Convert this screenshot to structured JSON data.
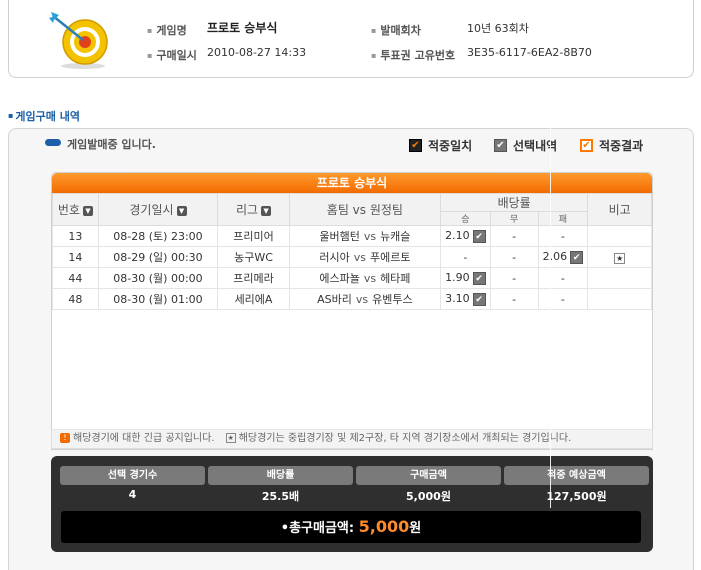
{
  "info": {
    "game_name_label": "게임명",
    "game_name": "프로토 승부식",
    "round_label": "발매회차",
    "round": "10년 63회차",
    "purchase_date_label": "구매일시",
    "purchase_date": "2010-08-27 14:33",
    "ticket_id_label": "투표권 고유번호",
    "ticket_id": "3E35-6117-6EA2-8B70"
  },
  "section_title": "게임구매 내역",
  "status_text": "게임발매중 입니다.",
  "legend": [
    {
      "label": "적중일치",
      "style": "black"
    },
    {
      "label": "선택내역",
      "style": "gray"
    },
    {
      "label": "적중결과",
      "style": "orange"
    }
  ],
  "table": {
    "title": "프로토 승부식",
    "headers": {
      "no": "번호",
      "datetime": "경기일시",
      "league": "리그",
      "teams": "홈팀 vs 원정팀",
      "odds": "배당률",
      "win": "승",
      "draw": "무",
      "lose": "패",
      "note": "비고"
    },
    "vs": "vs",
    "rows": [
      {
        "no": "13",
        "datetime": "08-28 (토) 23:00",
        "league": "프리미어",
        "home": "울버햄턴",
        "away": "뉴캐슬",
        "win": "2.10",
        "draw": "-",
        "lose": "-",
        "win_sel": true,
        "lose_sel": false,
        "star": false
      },
      {
        "no": "14",
        "datetime": "08-29 (일) 00:30",
        "league": "농구WC",
        "home": "러시아",
        "away": "푸에르토",
        "win": "-",
        "draw": "-",
        "lose": "2.06",
        "win_sel": false,
        "lose_sel": true,
        "star": true
      },
      {
        "no": "44",
        "datetime": "08-30 (월) 00:00",
        "league": "프리메라",
        "home": "에스파뇰",
        "away": "헤타페",
        "win": "1.90",
        "draw": "-",
        "lose": "-",
        "win_sel": true,
        "lose_sel": false,
        "star": false
      },
      {
        "no": "48",
        "datetime": "08-30 (월) 01:00",
        "league": "세리에A",
        "home": "AS바리",
        "away": "유벤투스",
        "win": "3.10",
        "draw": "-",
        "lose": "-",
        "win_sel": true,
        "lose_sel": false,
        "star": false
      }
    ]
  },
  "notice": {
    "text1": "해당경기에 대한 긴급 공지입니다.",
    "text2": "해당경기는 중립경기장 및 제2구장, 타 지역 경기장소에서 개최되는 경기입니다."
  },
  "summary": {
    "count_label": "선택 경기수",
    "count": "4",
    "odds_label": "배당률",
    "odds": "25.5배",
    "amount_label": "구매금액",
    "amount": "5,000원",
    "expected_label": "적중 예상금액",
    "expected": "127,500원",
    "total_label": "•총구매금액:",
    "total_amount": "5,000",
    "total_unit": "원"
  }
}
